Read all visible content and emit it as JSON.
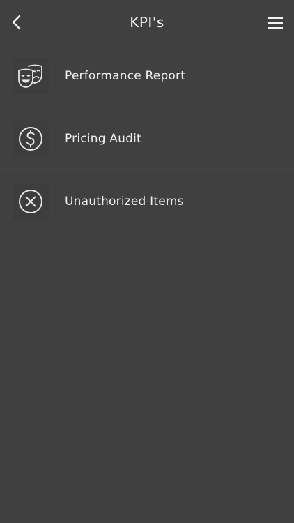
{
  "header": {
    "title": "KPI's",
    "back_icon": "chevron-left-icon",
    "menu_icon": "hamburger-menu-icon"
  },
  "items": [
    {
      "label": "Performance Report",
      "icon": "theater-masks-icon"
    },
    {
      "label": "Pricing Audit",
      "icon": "dollar-circle-icon"
    },
    {
      "label": "Unauthorized Items",
      "icon": "x-circle-icon"
    }
  ],
  "colors": {
    "background": "#404040",
    "text": "#f2f2f2",
    "icon": "#e6e6e6"
  }
}
